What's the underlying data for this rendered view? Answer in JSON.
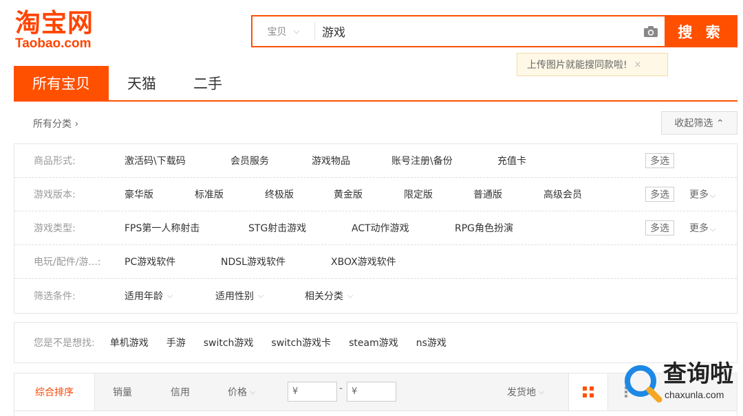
{
  "logo": {
    "cn": "淘宝网",
    "en": "Taobao.com"
  },
  "search": {
    "type_label": "宝贝",
    "query": "游戏",
    "button_label": "搜 索",
    "tooltip": "上传图片就能搜同款啦!",
    "tooltip_close": "×"
  },
  "tabs": [
    {
      "label": "所有宝贝",
      "active": true
    },
    {
      "label": "天猫"
    },
    {
      "label": "二手"
    }
  ],
  "crumb": "所有分类 ›",
  "collapse_label": "收起筛选 ⌃",
  "filters": {
    "multi_label": "多选",
    "more_label": "更多",
    "rows": [
      {
        "label": "商品形式:",
        "items": [
          "激活码\\下载码",
          "会员服务",
          "游戏物品",
          "账号注册\\备份",
          "充值卡"
        ]
      },
      {
        "label": "游戏版本:",
        "items": [
          "豪华版",
          "标准版",
          "终极版",
          "黄金版",
          "限定版",
          "普通版",
          "高级会员"
        ]
      },
      {
        "label": "游戏类型:",
        "items": [
          "FPS第一人称射击",
          "STG射击游戏",
          "ACT动作游戏",
          "RPG角色扮演"
        ]
      },
      {
        "label": "电玩/配件/游...:",
        "items": [
          "PC游戏软件",
          "NDSL游戏软件",
          "XBOX游戏软件"
        ]
      },
      {
        "label": "筛选条件:",
        "items": [
          "适用年龄",
          "适用性别",
          "相关分类"
        ]
      }
    ]
  },
  "suggest": {
    "label": "您是不是想找:",
    "items": [
      "单机游戏",
      "手游",
      "switch游戏",
      "switch游戏卡",
      "steam游戏",
      "ns游戏"
    ]
  },
  "sort": {
    "active": "综合排序",
    "sales": "销量",
    "credit": "信用",
    "price": "价格",
    "currency": "¥",
    "dash": "-",
    "ship_from": "发货地"
  },
  "watermark": {
    "text": "查询啦",
    "url": "chaxunla.com"
  },
  "colors": {
    "accent": "#ff5000",
    "accent_text": "#ff4400"
  }
}
